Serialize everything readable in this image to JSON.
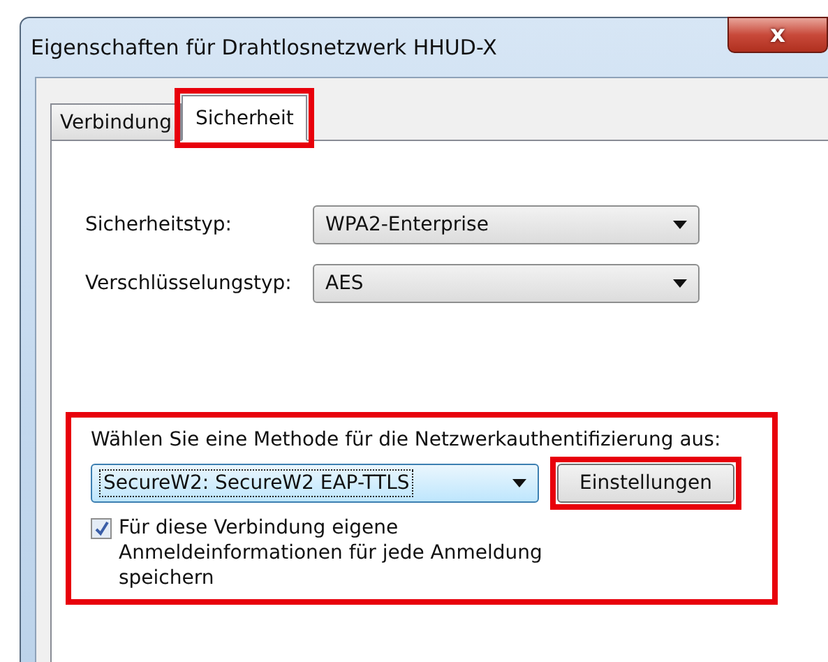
{
  "window": {
    "title": "Eigenschaften für Drahtlosnetzwerk HHUD-X",
    "close": "x"
  },
  "tabs": [
    {
      "label": "Verbindung",
      "selected": false,
      "highlighted": false
    },
    {
      "label": "Sicherheit",
      "selected": true,
      "highlighted": true
    }
  ],
  "fields": [
    {
      "label": "Sicherheitstyp:",
      "value": "WPA2-Enterprise"
    },
    {
      "label": "Verschlüsselungstyp:",
      "value": "AES"
    }
  ],
  "auth": {
    "highlighted": true,
    "label": "Wählen Sie eine Methode für die Netzwerkauthentifizierung aus:",
    "method": "SecureW2: SecureW2 EAP-TTLS",
    "focused": true,
    "button": {
      "label": "Einstellungen",
      "highlighted": true
    },
    "checkbox": {
      "label": "Für diese Verbindung eigene Anmeldeinformationen für jede Anmeldung speichern",
      "checked": true
    }
  }
}
